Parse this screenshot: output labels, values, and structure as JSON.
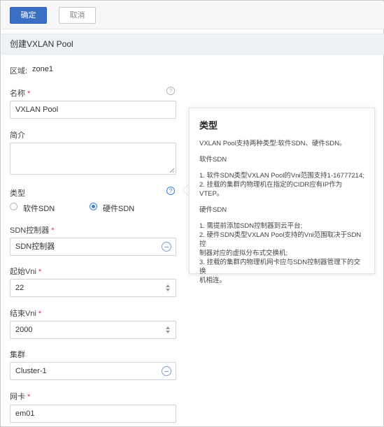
{
  "toolbar": {
    "confirm_label": "确定",
    "cancel_label": "取消"
  },
  "section": {
    "title": "创建VXLAN Pool"
  },
  "zone": {
    "label": "区域:",
    "value": "zone1"
  },
  "name": {
    "label": "名称",
    "required_mark": "*",
    "value": "VXLAN Pool",
    "help": "?"
  },
  "description": {
    "label": "简介",
    "value": ""
  },
  "type": {
    "label": "类型",
    "help": "?",
    "options": [
      {
        "label": "软件SDN",
        "selected": false
      },
      {
        "label": "硬件SDN",
        "selected": true
      }
    ]
  },
  "sdn_controller": {
    "label": "SDN控制器",
    "required_mark": "*",
    "value": "SDN控制器"
  },
  "start_vni": {
    "label": "起始Vni",
    "required_mark": "*",
    "value": "22"
  },
  "end_vni": {
    "label": "结束Vni",
    "required_mark": "*",
    "value": "2000"
  },
  "cluster": {
    "label": "集群",
    "value": "Cluster-1"
  },
  "nic": {
    "label": "网卡",
    "required_mark": "*",
    "value": "em01"
  },
  "tooltip": {
    "title": "类型",
    "intro": "VXLAN Pool支持两种类型:软件SDN、硬件SDN。",
    "software_heading": "软件SDN",
    "software_lines": [
      "1. 软件SDN类型VXLAN Pool的Vni范围支持1-16777214;",
      "2. 挂载的集群内物理机在指定的CIDR应有IP作为VTEP。"
    ],
    "hardware_heading": "硬件SDN",
    "hardware_lines": [
      "1. 需提前添加SDN控制器到云平台;",
      "2. 硬件SDN类型VXLAN Pool支持的Vni范围取决于SDN控",
      "制器对应的虚拟分布式交换机;",
      "3. 挂载的集群内物理机网卡应与SDN控制器管理下的交换",
      "机相连。"
    ]
  },
  "colors": {
    "primary": "#3a6fc4",
    "required": "#d9363e",
    "radio_active": "#3a7fd5"
  }
}
